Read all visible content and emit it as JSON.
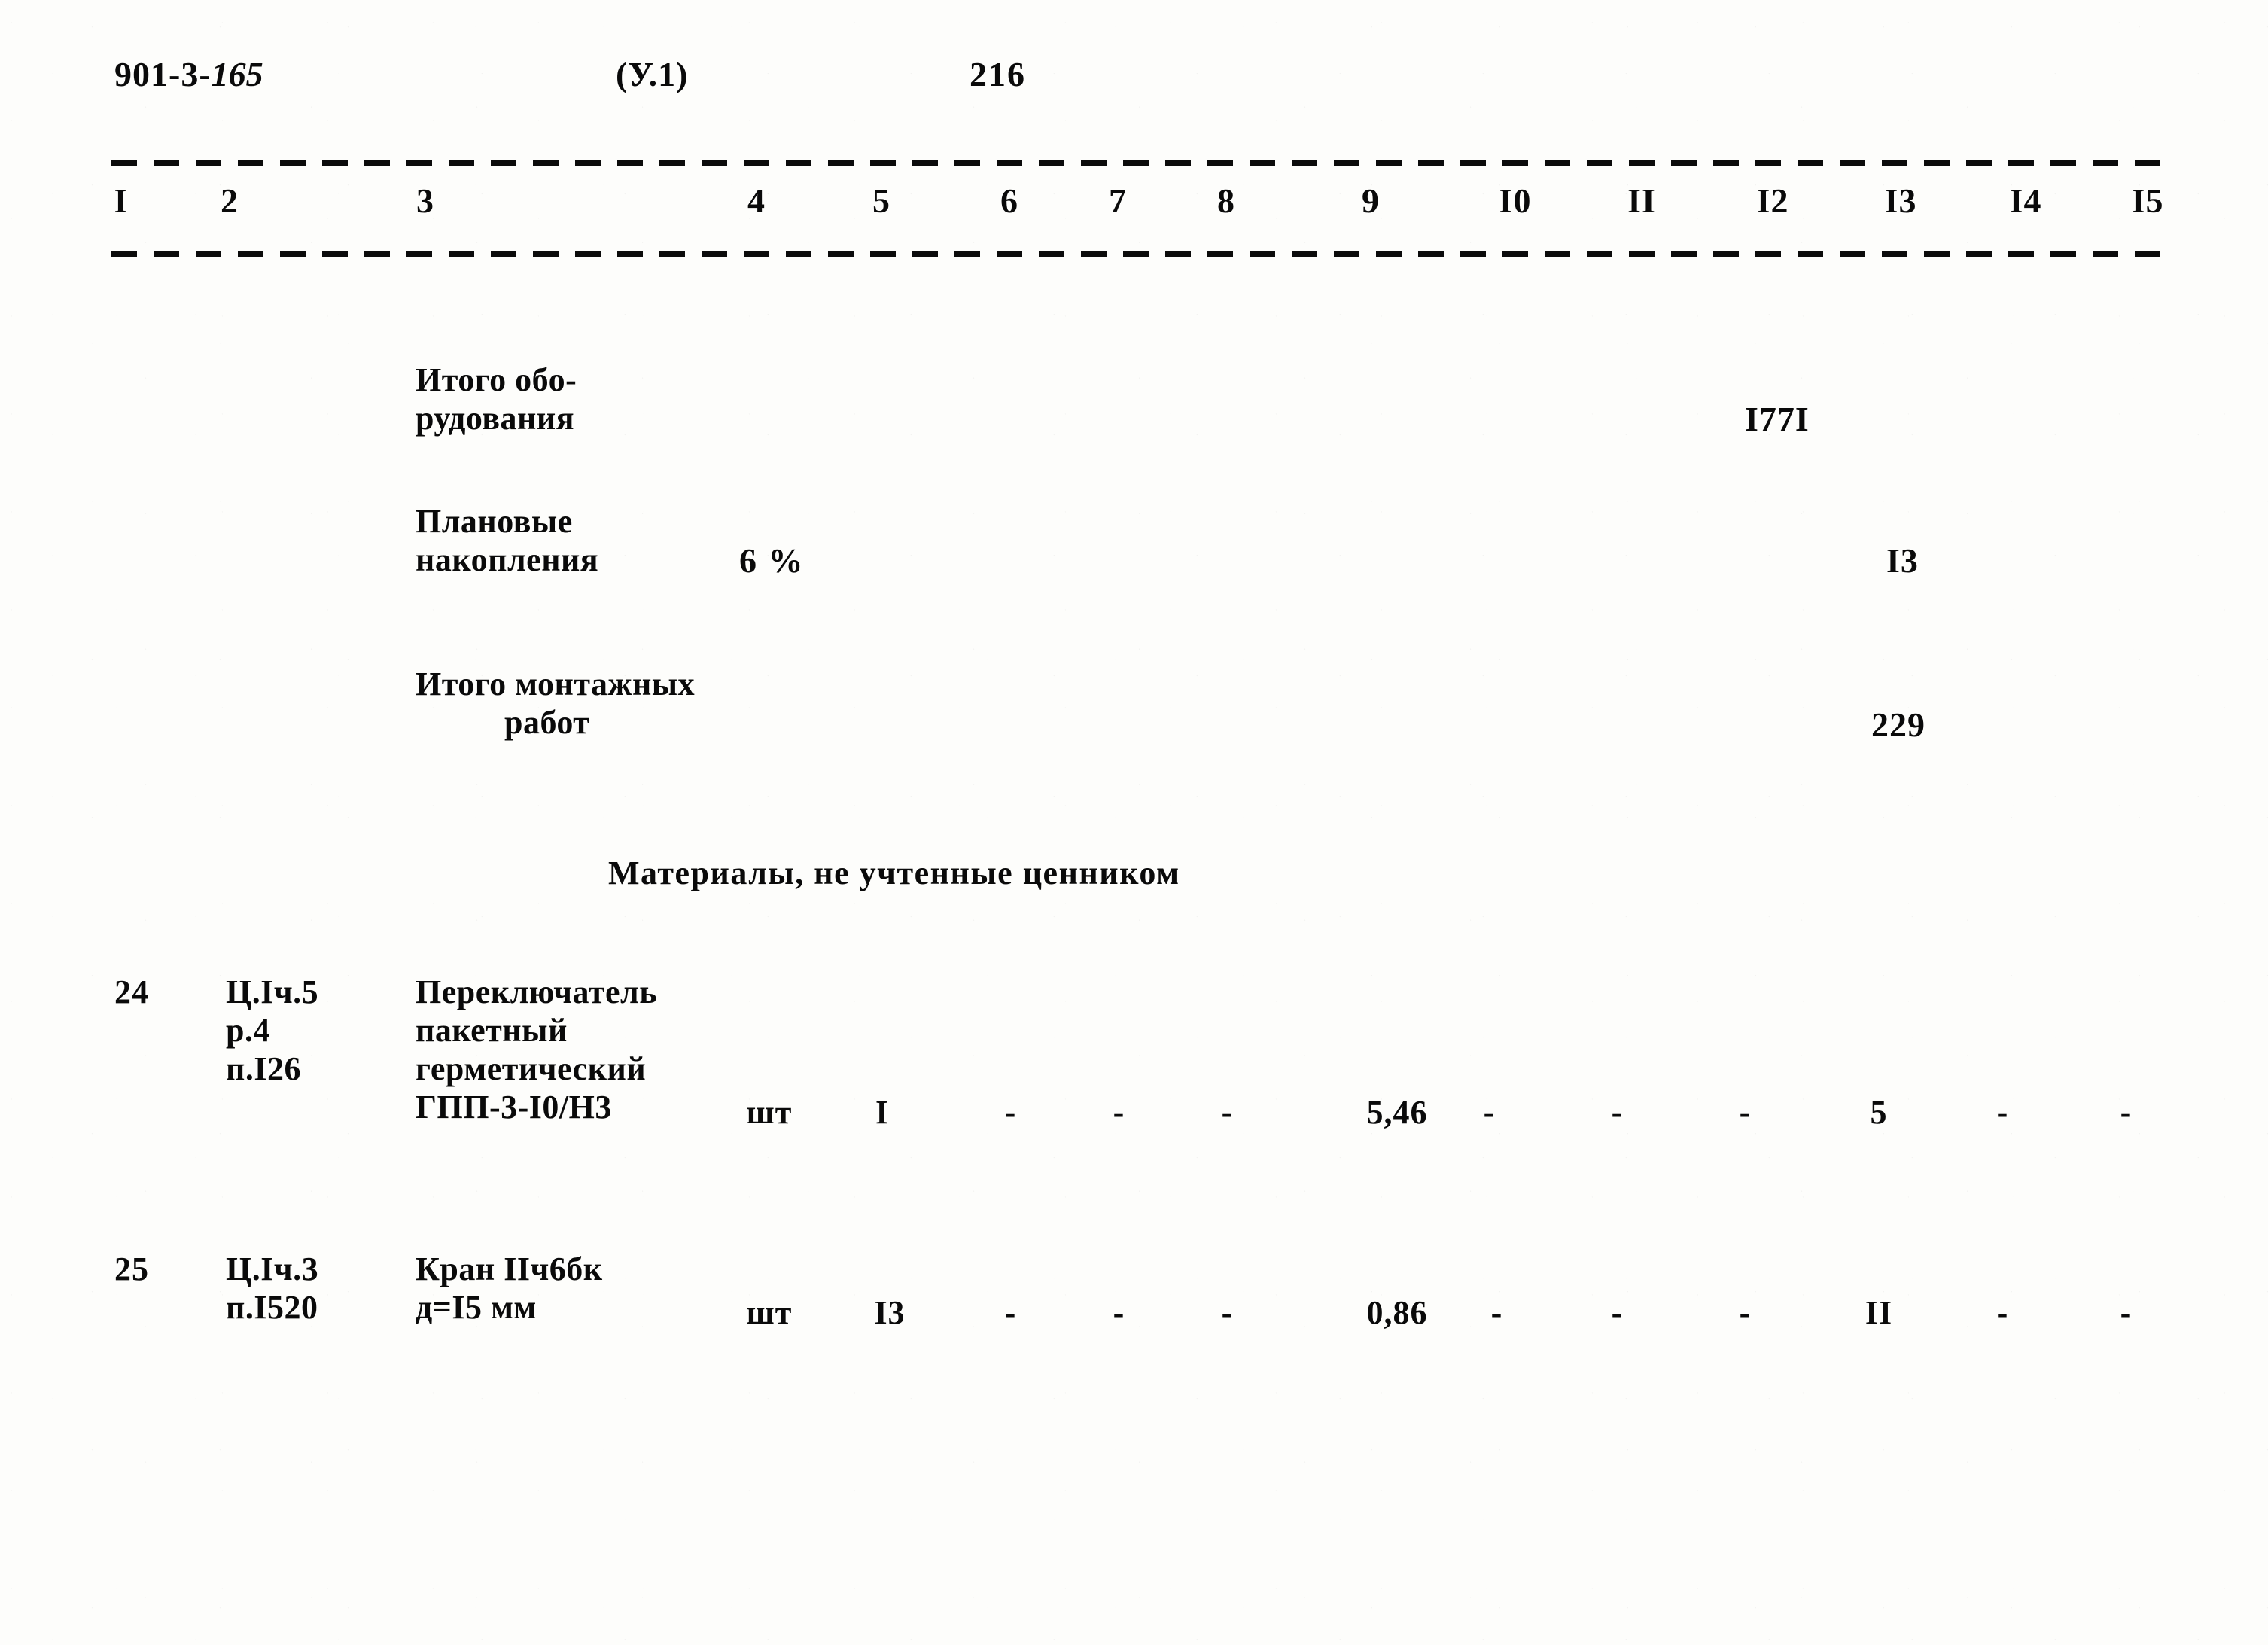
{
  "header": {
    "doc_code_prefix": "901-3-",
    "doc_code_suffix": "165",
    "part_label": "(У.1)",
    "page_number": "216"
  },
  "table": {
    "column_numbers": [
      "I",
      "2",
      "3",
      "4",
      "5",
      "6",
      "7",
      "8",
      "9",
      "I0",
      "II",
      "I2",
      "I3",
      "I4",
      "I5"
    ],
    "summary_rows": [
      {
        "label_line1": "Итого обо-",
        "label_line2": "рудования",
        "percent": "",
        "value": "I77I",
        "value_column": "I2"
      },
      {
        "label_line1": "Плановые",
        "label_line2": "накопления",
        "percent": "6 %",
        "value": "I3",
        "value_column": "I3"
      },
      {
        "label_line1": "Итого монтажных",
        "label_line2": "работ",
        "percent": "",
        "value": "229",
        "value_column": "I3"
      }
    ],
    "section_title": "Материалы, не учтенные ценником",
    "material_rows": [
      {
        "no": "24",
        "ref_line1": "Ц.Iч.5",
        "ref_line2": "р.4",
        "ref_line3": "п.I26",
        "desc_line1": "Переключатель",
        "desc_line2": "пакетный",
        "desc_line3": "герметический",
        "desc_line4": "ГПП-3-I0/Н3",
        "unit": "шт",
        "c5": "I",
        "c6": "-",
        "c7": "-",
        "c8": "-",
        "c9": "5,46",
        "c10": "-",
        "c11": "-",
        "c12": "-",
        "c13": "5",
        "c14": "-",
        "c15": "-"
      },
      {
        "no": "25",
        "ref_line1": "Ц.Iч.3",
        "ref_line2": "п.I520",
        "ref_line3": "",
        "desc_line1": "Кран IIч6бк",
        "desc_line2": "д=I5 мм",
        "desc_line3": "",
        "desc_line4": "",
        "unit": "шт",
        "c5": "I3",
        "c6": "-",
        "c7": "-",
        "c8": "-",
        "c9": "0,86",
        "c10": "-",
        "c11": "-",
        "c12": "-",
        "c13": "II",
        "c14": "-",
        "c15": "-"
      }
    ]
  },
  "colors": {
    "ink": "#090909",
    "paper": "#fdfdfb"
  }
}
